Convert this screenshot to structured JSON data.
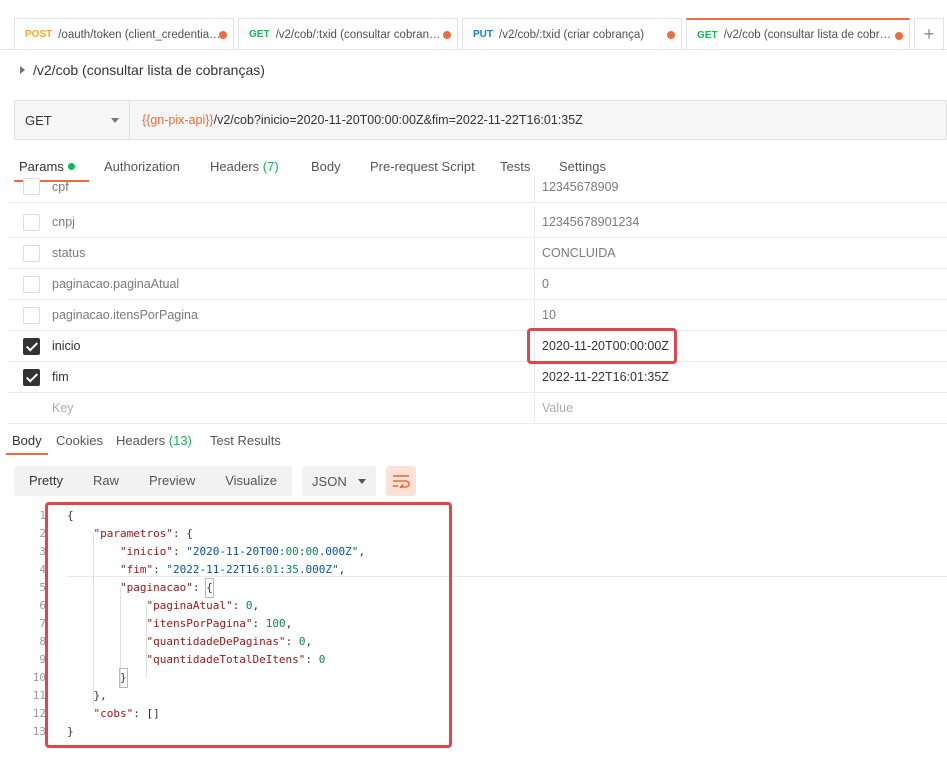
{
  "tabs": [
    {
      "method": "POST",
      "title": "/oauth/token (client_credentia…",
      "active": false
    },
    {
      "method": "GET",
      "title": "/v2/cob/:txid (consultar cobran…",
      "active": false
    },
    {
      "method": "PUT",
      "title": "/v2/cob/:txid (criar cobrança)",
      "active": false
    },
    {
      "method": "GET",
      "title": "/v2/cob (consultar lista de cobr…",
      "active": true
    }
  ],
  "tab_add_label": "+",
  "request_name": "/v2/cob (consultar lista de cobranças)",
  "request": {
    "method": "GET",
    "url_variable": "{{gn-pix-api}}",
    "url_path": "/v2/cob?inicio=2020-11-20T00:00:00Z&fim=2022-11-22T16:01:35Z"
  },
  "request_tabs": {
    "params": "Params",
    "authorization": "Authorization",
    "headers": "Headers",
    "headers_count": "(7)",
    "body": "Body",
    "prerequest": "Pre-request Script",
    "tests": "Tests",
    "settings": "Settings"
  },
  "params": [
    {
      "key": "cpf",
      "value": "12345678909",
      "checked": false
    },
    {
      "key": "cnpj",
      "value": "12345678901234",
      "checked": false
    },
    {
      "key": "status",
      "value": "CONCLUIDA",
      "checked": false
    },
    {
      "key": "paginacao.paginaAtual",
      "value": "0",
      "checked": false
    },
    {
      "key": "paginacao.itensPorPagina",
      "value": "10",
      "checked": false
    },
    {
      "key": "inicio",
      "value": "2020-11-20T00:00:00Z",
      "checked": true
    },
    {
      "key": "fim",
      "value": "2022-11-22T16:01:35Z",
      "checked": true
    }
  ],
  "params_placeholder": {
    "key": "Key",
    "value": "Value"
  },
  "response_tabs": {
    "body": "Body",
    "cookies": "Cookies",
    "headers": "Headers",
    "headers_count": "(13)",
    "test_results": "Test Results"
  },
  "response_formats": [
    "Pretty",
    "Raw",
    "Preview",
    "Visualize"
  ],
  "response_language": "JSON",
  "response_lines": [
    {
      "n": "1",
      "t": "{"
    },
    {
      "n": "2",
      "t": "    \"parametros\": {"
    },
    {
      "n": "3",
      "t": "        \"inicio\": \"2020-11-20T00:00:00.000Z\","
    },
    {
      "n": "4",
      "t": "        \"fim\": \"2022-11-22T16:01:35.000Z\","
    },
    {
      "n": "5",
      "t": "        \"paginacao\": {"
    },
    {
      "n": "6",
      "t": "            \"paginaAtual\": 0,"
    },
    {
      "n": "7",
      "t": "            \"itensPorPagina\": 100,"
    },
    {
      "n": "8",
      "t": "            \"quantidadeDePaginas\": 0,"
    },
    {
      "n": "9",
      "t": "            \"quantidadeTotalDeItens\": 0"
    },
    {
      "n": "10",
      "t": "        }"
    },
    {
      "n": "11",
      "t": "    },"
    },
    {
      "n": "12",
      "t": "    \"cobs\": []"
    },
    {
      "n": "13",
      "t": "}"
    }
  ],
  "colors": {
    "accent": "#f26b3a",
    "highlight_box": "#e0464c",
    "get": "#0cbb52",
    "post": "#f5a623",
    "put": "#097bed"
  }
}
